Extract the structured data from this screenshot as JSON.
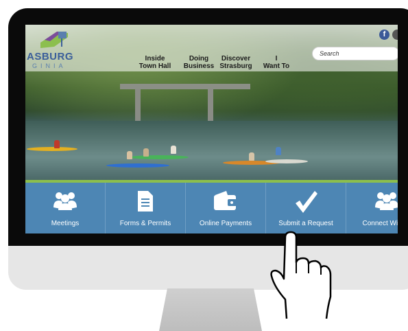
{
  "site": {
    "logo_text": "ASBURG",
    "logo_sub": "GINIA"
  },
  "nav": [
    {
      "line1": "Inside",
      "line2": "Town Hall"
    },
    {
      "line1": "Doing",
      "line2": "Business"
    },
    {
      "line1": "Discover",
      "line2": "Strasburg"
    },
    {
      "line1": "I",
      "line2": "Want To"
    }
  ],
  "search": {
    "placeholder": "Search"
  },
  "social": {
    "facebook_glyph": "f"
  },
  "tiles": [
    {
      "label": "Meetings",
      "icon": "people-icon"
    },
    {
      "label": "Forms & Permits",
      "icon": "document-icon"
    },
    {
      "label": "Online Payments",
      "icon": "wallet-icon"
    },
    {
      "label": "Submit a Request",
      "icon": "checkmark-icon"
    },
    {
      "label": "Connect With U",
      "icon": "group-icon"
    }
  ],
  "colors": {
    "tile_blue": "#4d86b4",
    "accent_green": "#8cbf4e",
    "logo_blue": "#3a5e9a"
  }
}
